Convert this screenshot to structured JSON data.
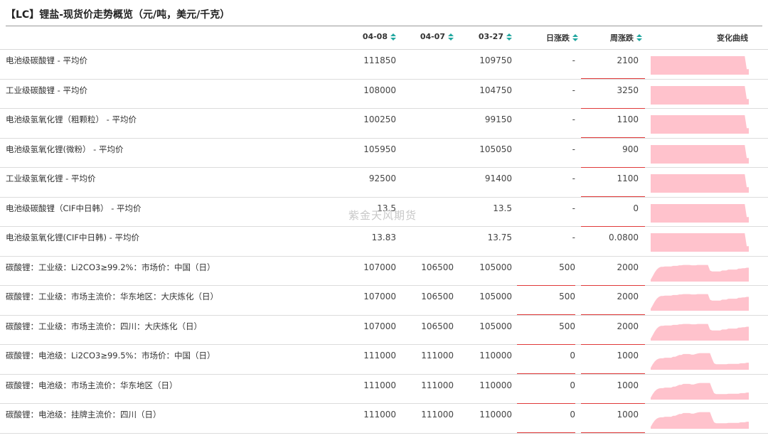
{
  "title": "【LC】锂盐-现货价走势概览（元/吨，美元/千克）",
  "watermark": "紫金天风期货",
  "headers": {
    "d1": "04-08",
    "d2": "04-07",
    "d3": "03-27",
    "day": "日涨跌",
    "week": "周涨跌",
    "curve": "变化曲线"
  },
  "colors": {
    "up": "#e03a3a",
    "spark_fill": "#ffc2cc",
    "sort_icon": "#22a7a0"
  },
  "rows": [
    {
      "name": "电池级碳酸锂 - 平均价",
      "d1": "111850",
      "d2": "",
      "d3": "109750",
      "day": "-",
      "week": "2100",
      "day_style": "gray",
      "week_style": "red",
      "day_line": false,
      "week_line": true,
      "spark": [
        1,
        1,
        1,
        1,
        1,
        1,
        1,
        1,
        1,
        1,
        1,
        1,
        1,
        1,
        1,
        1,
        1,
        1,
        1,
        1,
        1,
        1,
        1,
        1,
        1,
        1,
        1,
        1,
        1,
        1,
        1,
        1,
        1,
        1,
        1,
        1,
        1,
        1,
        1,
        1,
        1,
        1,
        1,
        1,
        1,
        1,
        1,
        0.3,
        0.3
      ]
    },
    {
      "name": "工业级碳酸锂 - 平均价",
      "d1": "108000",
      "d2": "",
      "d3": "104750",
      "day": "-",
      "week": "3250",
      "day_style": "gray",
      "week_style": "red",
      "day_line": false,
      "week_line": true,
      "spark": [
        1,
        1,
        1,
        1,
        1,
        1,
        1,
        1,
        1,
        1,
        1,
        1,
        1,
        1,
        1,
        1,
        1,
        1,
        1,
        1,
        1,
        1,
        1,
        1,
        1,
        1,
        1,
        1,
        1,
        1,
        1,
        1,
        1,
        1,
        1,
        1,
        1,
        1,
        1,
        1,
        1,
        1,
        1,
        1,
        1,
        1,
        1,
        0.3,
        0.3
      ]
    },
    {
      "name": "电池级氢氧化锂（粗颗粒） - 平均价",
      "d1": "100250",
      "d2": "",
      "d3": "99150",
      "day": "-",
      "week": "1100",
      "day_style": "gray",
      "week_style": "red",
      "day_line": false,
      "week_line": true,
      "spark": [
        1,
        1,
        1,
        1,
        1,
        1,
        1,
        1,
        1,
        1,
        1,
        1,
        1,
        1,
        1,
        1,
        1,
        1,
        1,
        1,
        1,
        1,
        1,
        1,
        1,
        1,
        1,
        1,
        1,
        1,
        1,
        1,
        1,
        1,
        1,
        1,
        1,
        1,
        1,
        1,
        1,
        1,
        1,
        1,
        1,
        1,
        1,
        0.3,
        0.3
      ]
    },
    {
      "name": "电池级氢氧化锂(微粉） - 平均价",
      "d1": "105950",
      "d2": "",
      "d3": "105050",
      "day": "-",
      "week": "900",
      "day_style": "gray",
      "week_style": "red",
      "day_line": false,
      "week_line": true,
      "spark": [
        1,
        1,
        1,
        1,
        1,
        1,
        1,
        1,
        1,
        1,
        1,
        1,
        1,
        1,
        1,
        1,
        1,
        1,
        1,
        1,
        1,
        1,
        1,
        1,
        1,
        1,
        1,
        1,
        1,
        1,
        1,
        1,
        1,
        1,
        1,
        1,
        1,
        1,
        1,
        1,
        1,
        1,
        1,
        1,
        1,
        1,
        1,
        0.3,
        0.3
      ]
    },
    {
      "name": "工业级氢氧化锂 - 平均价",
      "d1": "92500",
      "d2": "",
      "d3": "91400",
      "day": "-",
      "week": "1100",
      "day_style": "gray",
      "week_style": "red",
      "day_line": false,
      "week_line": true,
      "spark": [
        1,
        1,
        1,
        1,
        1,
        1,
        1,
        1,
        1,
        1,
        1,
        1,
        1,
        1,
        1,
        1,
        1,
        1,
        1,
        1,
        1,
        1,
        1,
        1,
        1,
        1,
        1,
        1,
        1,
        1,
        1,
        1,
        1,
        1,
        1,
        1,
        1,
        1,
        1,
        1,
        1,
        1,
        1,
        1,
        1,
        1,
        1,
        0.3,
        0.3
      ]
    },
    {
      "name": "电池级碳酸锂（CIF中日韩） - 平均价",
      "d1": "13.5",
      "d2": "",
      "d3": "13.5",
      "day": "-",
      "week": "0",
      "day_style": "gray",
      "week_style": "gray",
      "day_line": false,
      "week_line": true,
      "spark": [
        1,
        1,
        1,
        1,
        1,
        1,
        1,
        1,
        1,
        1,
        1,
        1,
        1,
        1,
        1,
        1,
        1,
        1,
        1,
        1,
        1,
        1,
        1,
        1,
        1,
        1,
        1,
        1,
        1,
        1,
        1,
        1,
        1,
        1,
        1,
        1,
        1,
        1,
        1,
        1,
        1,
        1,
        1,
        1,
        1,
        1,
        1,
        0.3,
        0.3
      ]
    },
    {
      "name": "电池级氢氧化锂(CIF中日韩) - 平均价",
      "d1": "13.83",
      "d2": "",
      "d3": "13.75",
      "day": "-",
      "week": "0.0800",
      "day_style": "gray",
      "week_style": "gray",
      "day_line": false,
      "week_line": false,
      "spark": [
        1,
        1,
        1,
        1,
        1,
        1,
        1,
        1,
        1,
        1,
        1,
        1,
        1,
        1,
        1,
        1,
        1,
        1,
        1,
        1,
        1,
        1,
        1,
        1,
        1,
        1,
        1,
        1,
        1,
        1,
        1,
        1,
        1,
        1,
        1,
        1,
        1,
        1,
        1,
        1,
        1,
        1,
        1,
        1,
        1,
        1,
        1,
        0.3,
        0.3
      ]
    },
    {
      "name": "碳酸锂：工业级：Li2CO3≥99.2%：市场价：中国（日）",
      "d1": "107000",
      "d2": "106500",
      "d3": "105000",
      "day": "500",
      "week": "2000",
      "day_style": "red",
      "week_style": "red",
      "day_line": true,
      "week_line": true,
      "spark": [
        0.1,
        0.3,
        0.5,
        0.65,
        0.75,
        0.8,
        0.8,
        0.82,
        0.82,
        0.82,
        0.82,
        0.85,
        0.85,
        0.85,
        0.88,
        0.88,
        0.9,
        0.9,
        0.9,
        0.9,
        0.88,
        0.88,
        0.88,
        0.9,
        0.9,
        0.9,
        0.9,
        0.9,
        0.9,
        0.6,
        0.55,
        0.55,
        0.55,
        0.55,
        0.55,
        0.6,
        0.6,
        0.6,
        0.65,
        0.65,
        0.65,
        0.65,
        0.65,
        0.7,
        0.7,
        0.72,
        0.72,
        0.75,
        0.75
      ]
    },
    {
      "name": "碳酸锂：工业级：市场主流价：华东地区：大庆炼化（日）",
      "d1": "107000",
      "d2": "106500",
      "d3": "105000",
      "day": "500",
      "week": "2000",
      "day_style": "red",
      "week_style": "red",
      "day_line": true,
      "week_line": true,
      "spark": [
        0.1,
        0.3,
        0.5,
        0.65,
        0.75,
        0.8,
        0.8,
        0.82,
        0.82,
        0.82,
        0.82,
        0.85,
        0.85,
        0.85,
        0.88,
        0.88,
        0.9,
        0.9,
        0.9,
        0.9,
        0.88,
        0.88,
        0.88,
        0.9,
        0.9,
        0.9,
        0.9,
        0.9,
        0.9,
        0.6,
        0.55,
        0.55,
        0.55,
        0.55,
        0.55,
        0.6,
        0.6,
        0.6,
        0.65,
        0.65,
        0.65,
        0.65,
        0.65,
        0.7,
        0.7,
        0.72,
        0.72,
        0.75,
        0.75
      ]
    },
    {
      "name": "碳酸锂：工业级：市场主流价：四川：大庆炼化（日）",
      "d1": "107000",
      "d2": "106500",
      "d3": "105000",
      "day": "500",
      "week": "2000",
      "day_style": "red",
      "week_style": "red",
      "day_line": true,
      "week_line": true,
      "spark": [
        0.1,
        0.3,
        0.5,
        0.65,
        0.75,
        0.8,
        0.8,
        0.82,
        0.82,
        0.82,
        0.82,
        0.85,
        0.85,
        0.85,
        0.88,
        0.88,
        0.9,
        0.9,
        0.9,
        0.9,
        0.88,
        0.88,
        0.88,
        0.9,
        0.9,
        0.9,
        0.9,
        0.9,
        0.9,
        0.6,
        0.55,
        0.55,
        0.55,
        0.55,
        0.55,
        0.6,
        0.6,
        0.6,
        0.65,
        0.65,
        0.65,
        0.65,
        0.65,
        0.7,
        0.7,
        0.72,
        0.72,
        0.75,
        0.75
      ]
    },
    {
      "name": "碳酸锂：电池级：Li2CO3≥99.5%：市场价：中国（日）",
      "d1": "111000",
      "d2": "111000",
      "d3": "110000",
      "day": "0",
      "week": "1000",
      "day_style": "gray",
      "week_style": "red",
      "day_line": true,
      "week_line": true,
      "spark": [
        0.1,
        0.3,
        0.45,
        0.55,
        0.6,
        0.62,
        0.62,
        0.65,
        0.65,
        0.65,
        0.65,
        0.7,
        0.7,
        0.75,
        0.8,
        0.8,
        0.85,
        0.85,
        0.85,
        0.85,
        0.82,
        0.82,
        0.85,
        0.88,
        0.9,
        0.9,
        0.9,
        0.9,
        0.9,
        0.9,
        0.6,
        0.35,
        0.3,
        0.3,
        0.3,
        0.3,
        0.3,
        0.3,
        0.32,
        0.32,
        0.32,
        0.32,
        0.32,
        0.32,
        0.35,
        0.35,
        0.35,
        0.38,
        0.38
      ]
    },
    {
      "name": "碳酸锂：电池级：市场主流价：华东地区（日）",
      "d1": "111000",
      "d2": "111000",
      "d3": "110000",
      "day": "0",
      "week": "1000",
      "day_style": "gray",
      "week_style": "red",
      "day_line": true,
      "week_line": true,
      "spark": [
        0.1,
        0.3,
        0.45,
        0.55,
        0.6,
        0.62,
        0.62,
        0.65,
        0.65,
        0.65,
        0.65,
        0.7,
        0.7,
        0.75,
        0.8,
        0.8,
        0.85,
        0.85,
        0.85,
        0.85,
        0.82,
        0.82,
        0.85,
        0.88,
        0.9,
        0.9,
        0.9,
        0.9,
        0.9,
        0.9,
        0.6,
        0.35,
        0.3,
        0.3,
        0.3,
        0.3,
        0.3,
        0.3,
        0.32,
        0.32,
        0.32,
        0.32,
        0.32,
        0.32,
        0.35,
        0.35,
        0.35,
        0.38,
        0.38
      ]
    },
    {
      "name": "碳酸锂：电池级：挂牌主流价：四川（日）",
      "d1": "111000",
      "d2": "111000",
      "d3": "110000",
      "day": "0",
      "week": "1000",
      "day_style": "gray",
      "week_style": "red",
      "day_line": true,
      "week_line": true,
      "spark": [
        0.1,
        0.3,
        0.45,
        0.55,
        0.6,
        0.62,
        0.62,
        0.65,
        0.65,
        0.65,
        0.65,
        0.7,
        0.7,
        0.75,
        0.8,
        0.8,
        0.85,
        0.85,
        0.85,
        0.85,
        0.82,
        0.82,
        0.85,
        0.88,
        0.9,
        0.9,
        0.9,
        0.9,
        0.9,
        0.9,
        0.6,
        0.35,
        0.3,
        0.3,
        0.3,
        0.3,
        0.3,
        0.3,
        0.32,
        0.32,
        0.32,
        0.32,
        0.32,
        0.32,
        0.35,
        0.35,
        0.35,
        0.38,
        0.38
      ]
    }
  ]
}
